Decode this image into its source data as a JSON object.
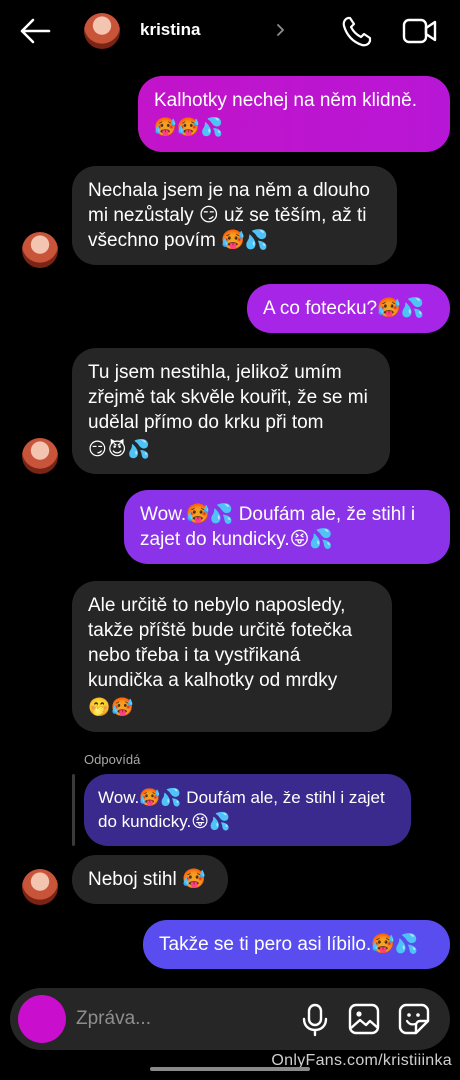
{
  "header": {
    "contact_name": "kristina"
  },
  "messages": [
    {
      "side": "out",
      "text": "Kalhotky nechej na něm klidně.",
      "emoji": "🥵🥵💦"
    },
    {
      "side": "in",
      "text": "Nechala jsem je na něm a dlouho mi nezůstaly 😏 už se těším, až ti všechno povím 🥵💦"
    },
    {
      "side": "out",
      "text": "A co fotecku?🥵💦"
    },
    {
      "side": "in",
      "text": "Tu jsem nestihla, jelikož umím zřejmě tak skvěle kouřit, že se mi udělal přímo do krku při tom",
      "emoji": "😏😈💦"
    },
    {
      "side": "out",
      "text": "Wow.🥵💦 Doufám ale, že stihl i zajet do kundicky.😝💦"
    },
    {
      "side": "in",
      "text": "Ale určitě to nebylo naposledy, takže příště bude určitě fotečka nebo třeba i ta vystřikaná kundička a kalhotky od mrdky",
      "emoji": "🤭🥵"
    },
    {
      "side": "quote",
      "label": "Odpovídá",
      "text": "Wow.🥵💦 Doufám ale, že stihl i zajet do kundicky.😝💦"
    },
    {
      "side": "in",
      "text": "Neboj stihl 🥵"
    },
    {
      "side": "out",
      "text": "Takže se ti pero asi líbilo.🥵💦"
    }
  ],
  "composer": {
    "placeholder": "Zpráva..."
  },
  "watermark": "OnlyFans.com/kristiiinka",
  "colors": {
    "background": "#000000",
    "incoming_bubble": "#262626",
    "outgoing_top": "#c214c9",
    "outgoing_bottom": "#5a4df0",
    "camera_button": "#c90ecd"
  },
  "icons": [
    "back-arrow-icon",
    "chevron-right-icon",
    "phone-icon",
    "video-camera-icon",
    "microphone-icon",
    "gallery-icon",
    "sticker-icon"
  ]
}
